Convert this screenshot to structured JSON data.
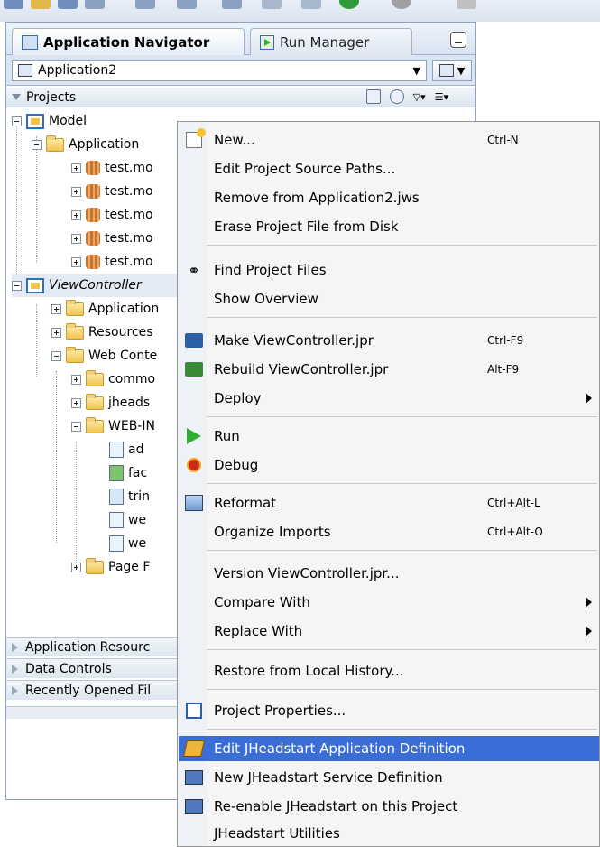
{
  "navigator": {
    "tabs": [
      {
        "label": "Application Navigator",
        "active": true
      },
      {
        "label": "Run Manager",
        "active": false
      }
    ],
    "application_combo": {
      "value": "Application2"
    },
    "projects_header": "Projects",
    "tree": [
      {
        "label": "Model"
      },
      {
        "label": "Application"
      },
      {
        "label": "test.mo"
      },
      {
        "label": "test.mo"
      },
      {
        "label": "test.mo"
      },
      {
        "label": "test.mo"
      },
      {
        "label": "test.mo"
      },
      {
        "label": "ViewController"
      },
      {
        "label": "Application"
      },
      {
        "label": "Resources"
      },
      {
        "label": "Web Conte"
      },
      {
        "label": "commo"
      },
      {
        "label": "jheads"
      },
      {
        "label": "WEB-IN"
      },
      {
        "label": "ad"
      },
      {
        "label": "fac"
      },
      {
        "label": "trin"
      },
      {
        "label": "we"
      },
      {
        "label": "we"
      },
      {
        "label": "Page F"
      }
    ],
    "sections": [
      {
        "label": "Application Resourc"
      },
      {
        "label": "Data Controls"
      },
      {
        "label": "Recently Opened Fil"
      }
    ]
  },
  "context_menu": {
    "items": [
      {
        "label": "New...",
        "accel": "Ctrl-N",
        "icon": "new-icon"
      },
      {
        "label": "Edit Project Source Paths...",
        "accel": ""
      },
      {
        "label": "Remove from Application2.jws",
        "accel": ""
      },
      {
        "label": "Erase Project File from Disk",
        "accel": ""
      },
      {
        "label": "Find Project Files",
        "accel": "",
        "icon": "binoculars-icon"
      },
      {
        "label": "Show Overview",
        "accel": ""
      },
      {
        "label": "Make ViewController.jpr",
        "accel": "Ctrl-F9",
        "icon": "make-icon"
      },
      {
        "label": "Rebuild ViewController.jpr",
        "accel": "Alt-F9",
        "icon": "rebuild-icon"
      },
      {
        "label": "Deploy",
        "accel": "",
        "submenu": true
      },
      {
        "label": "Run",
        "accel": "",
        "icon": "run-icon"
      },
      {
        "label": "Debug",
        "accel": "",
        "icon": "debug-icon"
      },
      {
        "label": "Reformat",
        "accel": "Ctrl+Alt-L",
        "icon": "reformat-icon"
      },
      {
        "label": "Organize Imports",
        "accel": "Ctrl+Alt-O"
      },
      {
        "label": "Version ViewController.jpr...",
        "accel": ""
      },
      {
        "label": "Compare With",
        "accel": "",
        "submenu": true
      },
      {
        "label": "Replace With",
        "accel": "",
        "submenu": true
      },
      {
        "label": "Restore from Local History...",
        "accel": ""
      },
      {
        "label": "Project Properties...",
        "accel": "",
        "icon": "properties-icon"
      },
      {
        "label": "Edit JHeadstart Application Definition",
        "accel": "",
        "icon": "jheadstart-edit-icon",
        "highlighted": true
      },
      {
        "label": "New JHeadstart Service Definition",
        "accel": "",
        "icon": "jheadstart-icon"
      },
      {
        "label": "Re-enable JHeadstart on this Project",
        "accel": "",
        "icon": "jheadstart-icon"
      },
      {
        "label": "JHeadstart Utilities",
        "accel": ""
      }
    ]
  }
}
